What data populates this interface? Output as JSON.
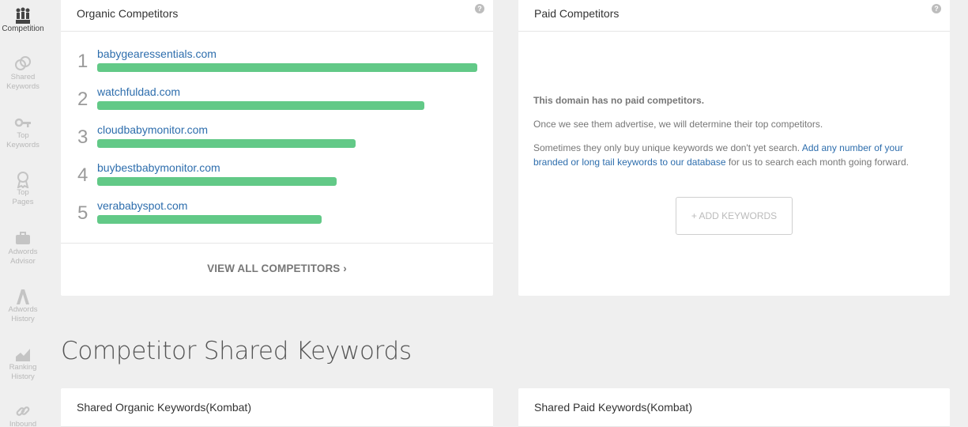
{
  "sidebar": {
    "items": [
      {
        "label_1": "Competition",
        "label_2": "",
        "icon": "competition-icon",
        "active": true
      },
      {
        "label_1": "Shared",
        "label_2": "Keywords",
        "icon": "shared-keywords-icon"
      },
      {
        "label_1": "Top",
        "label_2": "Keywords",
        "icon": "key-icon"
      },
      {
        "label_1": "Top",
        "label_2": "Pages",
        "icon": "ribbon-icon"
      },
      {
        "label_1": "Adwords",
        "label_2": "Advisor",
        "icon": "briefcase-icon"
      },
      {
        "label_1": "Adwords",
        "label_2": "History",
        "icon": "adwords-icon"
      },
      {
        "label_1": "Ranking",
        "label_2": "History",
        "icon": "chart-icon"
      },
      {
        "label_1": "Inbound",
        "label_2": "",
        "icon": "link-icon"
      }
    ]
  },
  "organic": {
    "title": "Organic Competitors",
    "help": "?",
    "competitors": [
      {
        "rank": "1",
        "domain": "babygearessentials.com",
        "share": 1.0
      },
      {
        "rank": "2",
        "domain": "watchfuldad.com",
        "share": 0.86
      },
      {
        "rank": "3",
        "domain": "cloudbabymonitor.com",
        "share": 0.68
      },
      {
        "rank": "4",
        "domain": "buybestbabymonitor.com",
        "share": 0.63
      },
      {
        "rank": "5",
        "domain": "verababyspot.com",
        "share": 0.59
      }
    ],
    "view_all": "VIEW ALL COMPETITORS ›"
  },
  "paid": {
    "title": "Paid Competitors",
    "help": "?",
    "no_data": "This domain has no paid competitors.",
    "line2": "Once we see them advertise, we will determine their top competitors.",
    "line3_prefix": "Sometimes they only buy unique keywords we don't yet search. ",
    "line3_link": "Add any number of your branded or long tail keywords to our database",
    "line3_suffix": " for us to search each month going forward.",
    "add_button": "+ ADD KEYWORDS"
  },
  "section_title": "Competitor Shared Keywords",
  "shared_organic_title": "Shared Organic Keywords(Kombat)",
  "shared_paid_title": "Shared Paid Keywords(Kombat)",
  "colors": {
    "bar": "#62c987",
    "link": "#2e6ead"
  }
}
